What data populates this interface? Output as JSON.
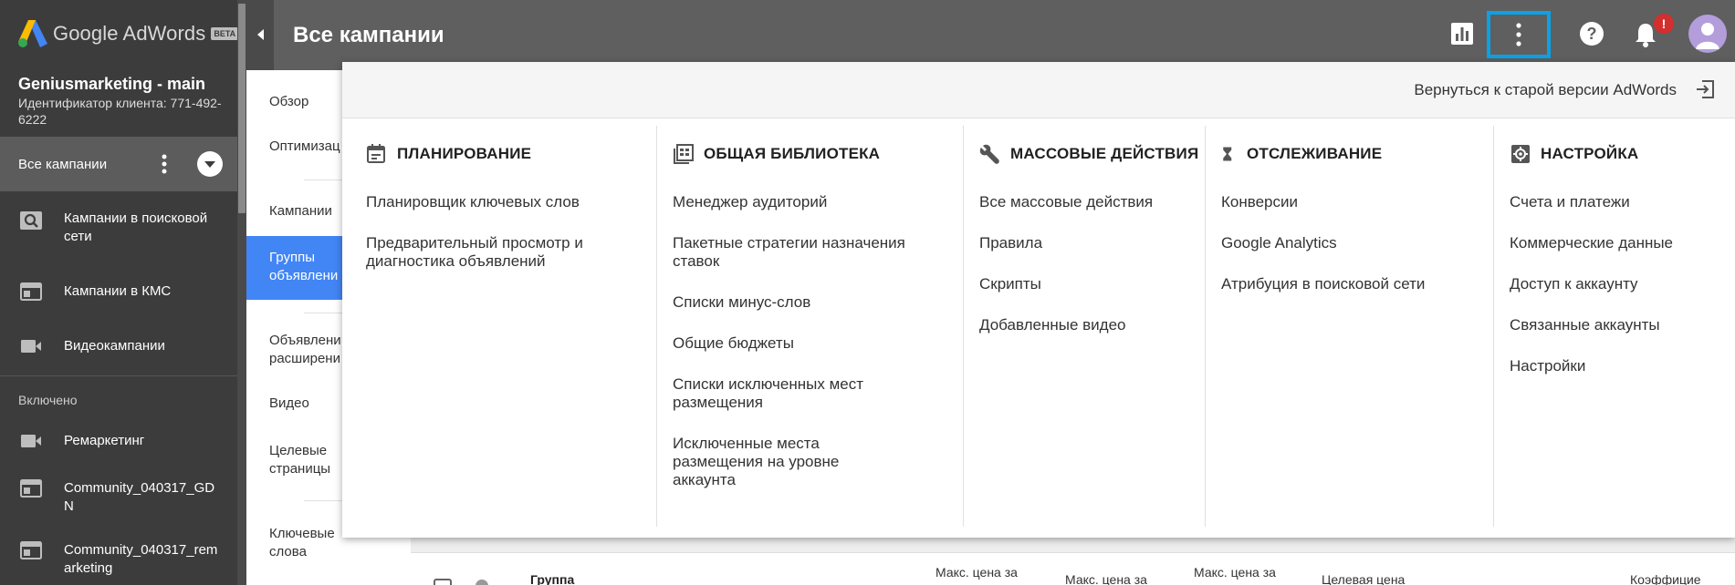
{
  "sidebar": {
    "logo_text": "Google AdWords",
    "beta_label": "BETA",
    "account_name": "Geniusmarketing - main",
    "client_id": "Идентификатор клиента: 771-492-6222",
    "all_campaigns": "Все кампании",
    "items": [
      {
        "icon": "search-campaign-icon",
        "label": "Кампании в поисковой сети"
      },
      {
        "icon": "display-campaign-icon",
        "label": "Кампании в КМС"
      },
      {
        "icon": "video-camera-icon",
        "label": "Видеокампании"
      }
    ],
    "section_label": "Включено",
    "enabled_items": [
      {
        "icon": "video-camera-icon",
        "label": "Ремаркетинг"
      },
      {
        "icon": "display-campaign-icon",
        "label": "Community_040317_GDN"
      },
      {
        "icon": "display-campaign-icon",
        "label": "Community_040317_remarketing"
      }
    ]
  },
  "header": {
    "title": "Все кампании",
    "notification_count": "!"
  },
  "subnav": {
    "items": [
      "Обзор",
      "Оптимизац",
      "Кампании",
      "Группы объявлени",
      "Объявлени расширени",
      "Видео",
      "Целевые страницы",
      "Ключевые слова"
    ],
    "active_index": 3
  },
  "panel": {
    "old_version": "Вернуться к старой версии AdWords",
    "columns": [
      {
        "icon": "calendar-icon",
        "title": "ПЛАНИРОВАНИЕ",
        "links": [
          "Планировщик ключевых слов",
          "Предварительный просмотр и диагностика объявлений"
        ]
      },
      {
        "icon": "library-icon",
        "title": "ОБЩАЯ БИБЛИОТЕКА",
        "links": [
          "Менеджер аудиторий",
          "Пакетные стратегии назначения ставок",
          "Списки минус-слов",
          "Общие бюджеты",
          "Списки исключенных мест размещения",
          "Исключенные места размещения на уровне аккаунта"
        ]
      },
      {
        "icon": "wrench-icon",
        "title": "МАССОВЫЕ ДЕЙСТВИЯ",
        "links": [
          "Все массовые действия",
          "Правила",
          "Скрипты",
          "Добавленные видео"
        ]
      },
      {
        "icon": "hourglass-icon",
        "title": "ОТСЛЕЖИВАНИЕ",
        "links": [
          "Конверсии",
          "Google Analytics",
          "Атрибуция в поисковой сети"
        ]
      },
      {
        "icon": "gear-icon",
        "title": "НАСТРОЙКА",
        "links": [
          "Счета и платежи",
          "Коммерческие данные",
          "Доступ к аккаунту",
          "Связанные аккаунты",
          "Настройки"
        ]
      }
    ]
  },
  "table_headers": [
    "Группа",
    "Макс. цена за",
    "Макс. цена за",
    "Макс. цена за",
    "Целевая цена",
    "Коэффицие"
  ]
}
